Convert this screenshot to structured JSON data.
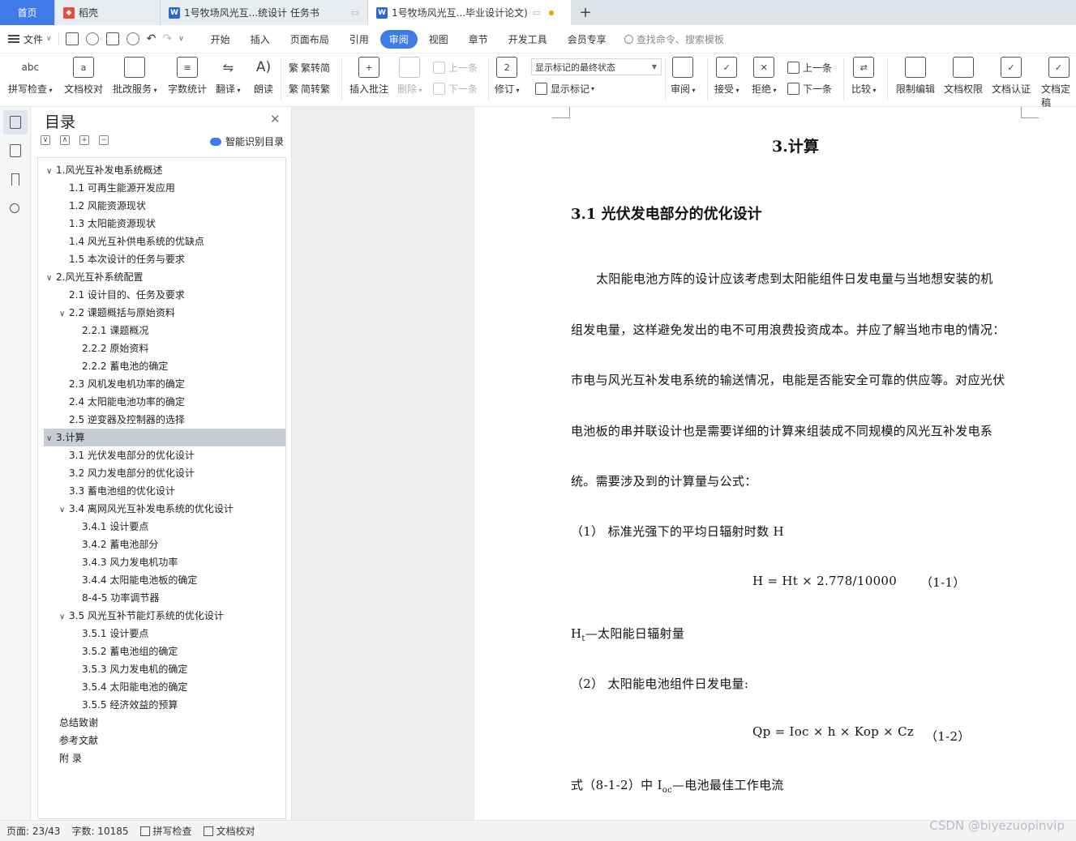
{
  "tabs": [
    {
      "label": "首页"
    },
    {
      "label": "稻壳"
    },
    {
      "label": "1号牧场风光互...统设计 任务书"
    },
    {
      "label": "1号牧场风光互...毕业设计论文)"
    }
  ],
  "menubar": {
    "file": "文件",
    "tabs": [
      "开始",
      "插入",
      "页面布局",
      "引用",
      "审阅",
      "视图",
      "章节",
      "开发工具",
      "会员专享"
    ],
    "active_tab": "审阅",
    "search": "查找命令、搜索模板"
  },
  "ribbon": {
    "spell_check": "拼写检查",
    "doc_proof": "文档校对",
    "review_service": "批改服务",
    "word_count": "字数统计",
    "translate": "翻译",
    "read_aloud": "朗读",
    "trad_to_simp": "繁转简",
    "simp_to_trad": "简转繁",
    "insert_comment": "插入批注",
    "delete": "删除",
    "prev_comment": "上一条",
    "next_comment": "下一条",
    "revise": "修订",
    "show_state": "显示标记的最终状态",
    "show_marks": "显示标记",
    "review": "审阅",
    "accept": "接受",
    "reject": "拒绝",
    "prev_change": "上一条",
    "next_change": "下一条",
    "compare": "比较",
    "restrict_edit": "限制编辑",
    "doc_permission": "文档权限",
    "doc_certify": "文档认证",
    "doc_final": "文档定稿"
  },
  "toc": {
    "title": "目录",
    "smart_btn": "智能识别目录",
    "items": [
      {
        "text": "1.风光互补发电系统概述",
        "level": 1,
        "chev": "∨"
      },
      {
        "text": "1.1  可再生能源开发应用",
        "level": 2,
        "chev": ""
      },
      {
        "text": "1.2  风能资源现状",
        "level": 2,
        "chev": ""
      },
      {
        "text": "1.3  太阳能资源现状",
        "level": 2,
        "chev": ""
      },
      {
        "text": "1.4  风光互补供电系统的优缺点",
        "level": 2,
        "chev": ""
      },
      {
        "text": "1.5 本次设计的任务与要求",
        "level": 2,
        "chev": ""
      },
      {
        "text": "2.风光互补系统配置",
        "level": 1,
        "chev": "∨"
      },
      {
        "text": "2.1 设计目的、任务及要求",
        "level": 2,
        "chev": ""
      },
      {
        "text": "2.2 课题概括与原始资料",
        "level": 2,
        "chev": "∨"
      },
      {
        "text": "2.2.1 课题概况",
        "level": 3,
        "chev": ""
      },
      {
        "text": "2.2.2 原始资料",
        "level": 3,
        "chev": ""
      },
      {
        "text": "2.2.2 蓄电池的确定",
        "level": 3,
        "chev": ""
      },
      {
        "text": "2.3 风机发电机功率的确定",
        "level": 2,
        "chev": ""
      },
      {
        "text": "2.4 太阳能电池功率的确定",
        "level": 2,
        "chev": ""
      },
      {
        "text": "2.5 逆变器及控制器的选择",
        "level": 2,
        "chev": ""
      },
      {
        "text": "3.计算",
        "level": 1,
        "chev": "∨",
        "selected": true
      },
      {
        "text": "3.1 光伏发电部分的优化设计",
        "level": 2,
        "chev": ""
      },
      {
        "text": "3.2 风力发电部分的优化设计",
        "level": 2,
        "chev": ""
      },
      {
        "text": "3.3 蓄电池组的优化设计",
        "level": 2,
        "chev": ""
      },
      {
        "text": "3.4  离网风光互补发电系统的优化设计",
        "level": 2,
        "chev": "∨"
      },
      {
        "text": "3.4.1 设计要点",
        "level": 3,
        "chev": ""
      },
      {
        "text": "3.4.2 蓄电池部分",
        "level": 3,
        "chev": ""
      },
      {
        "text": "3.4.3 风力发电机功率",
        "level": 3,
        "chev": ""
      },
      {
        "text": "3.4.4 太阳能电池板的确定",
        "level": 3,
        "chev": ""
      },
      {
        "text": "8-4-5 功率调节器",
        "level": 3,
        "chev": ""
      },
      {
        "text": "3.5  风光互补节能灯系统的优化设计",
        "level": 2,
        "chev": "∨"
      },
      {
        "text": "3.5.1 设计要点",
        "level": 3,
        "chev": ""
      },
      {
        "text": "3.5.2 蓄电池组的确定",
        "level": 3,
        "chev": ""
      },
      {
        "text": "3.5.3 风力发电机的确定",
        "level": 3,
        "chev": ""
      },
      {
        "text": "3.5.4 太阳能电池的确定",
        "level": 3,
        "chev": ""
      },
      {
        "text": "3.5.5 经济效益的预算",
        "level": 3,
        "chev": ""
      },
      {
        "text": "总结致谢",
        "level": 0,
        "chev": ""
      },
      {
        "text": "参考文献",
        "level": 0,
        "chev": ""
      },
      {
        "text": "附  录",
        "level": 0,
        "chev": ""
      }
    ]
  },
  "document": {
    "heading1": "3.计算",
    "heading2": "3.1 光伏发电部分的优化设计",
    "para_lines": [
      "太阳能电池方阵的设计应该考虑到太阳能组件日发电量与当地想安装的机",
      "组发电量，这样避免发出的电不可用浪费投资成本。并应了解当地市电的情况：",
      "市电与风光互补发电系统的输送情况，电能是否能安全可靠的供应等。对应光伏",
      "电池板的串并联设计也是需要详细的计算来组装成不同规模的风光互补发电系",
      "统。需要涉及到的计算量与公式："
    ],
    "item1": "（1）  标准光强下的平均日辐射时数 H",
    "formula1": "H = Ht × 2.778/10000",
    "formula1_no": "（1-1）",
    "ht_main": "H",
    "ht_sub": "t",
    "ht_desc": "—太阳能日辐射量",
    "item2": "（2）  太阳能电池组件日发电量:",
    "formula2": "Qp = Ioc × h × Kop × Cz",
    "formula2_no": "（1-2）",
    "last_prefix": "式（8-1-2）中 I",
    "last_sub": "oc",
    "last_suffix": "—电池最佳工作电流"
  },
  "status": {
    "page": "页面: 23/43",
    "words": "字数: 10185",
    "spell": "拼写检查",
    "proof": "文档校对"
  },
  "watermark": "CSDN @biyezuopinvip"
}
